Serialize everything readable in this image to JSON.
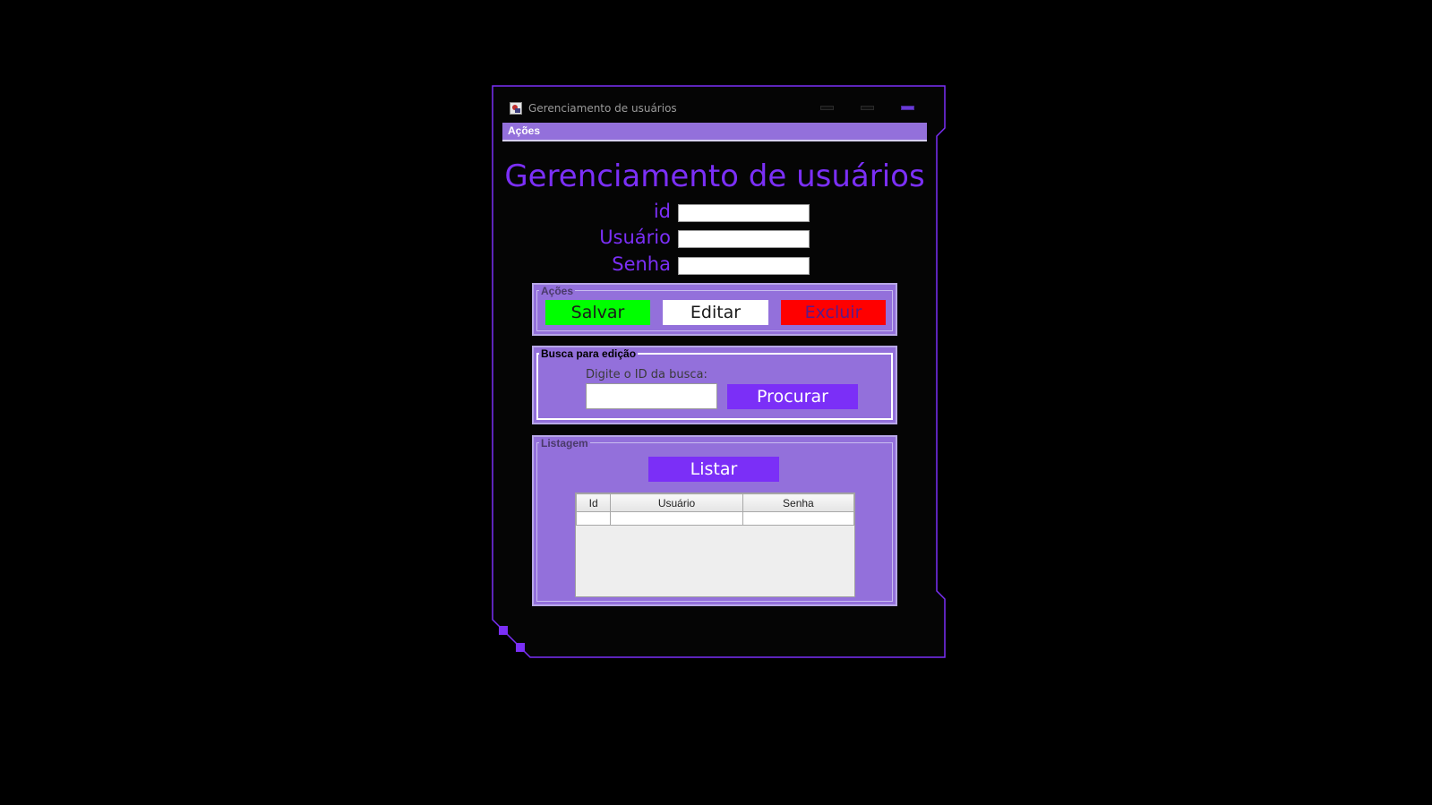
{
  "window": {
    "title": "Gerenciamento de usuários",
    "accent_color": "#7b2ff7",
    "panel_color": "#9370db"
  },
  "menu": {
    "items": [
      {
        "label": "Ações"
      }
    ]
  },
  "form": {
    "title": "Gerenciamento de usuários",
    "fields": [
      {
        "label": "id",
        "value": ""
      },
      {
        "label": "Usuário",
        "value": ""
      },
      {
        "label": "Senha",
        "value": ""
      }
    ]
  },
  "actions_panel": {
    "legend": "Ações",
    "salvar": "Salvar",
    "editar": "Editar",
    "excluir": "Excluir",
    "colors": {
      "salvar": "#00ff00",
      "editar": "#ffffff",
      "excluir": "#ff0000"
    }
  },
  "search_panel": {
    "legend": "Busca para edição",
    "prompt": "Digite o ID da busca:",
    "value": "",
    "button": "Procurar"
  },
  "list_panel": {
    "legend": "Listagem",
    "button": "Listar",
    "columns": [
      "Id",
      "Usuário",
      "Senha"
    ],
    "rows": [
      [
        "",
        "",
        ""
      ]
    ]
  }
}
